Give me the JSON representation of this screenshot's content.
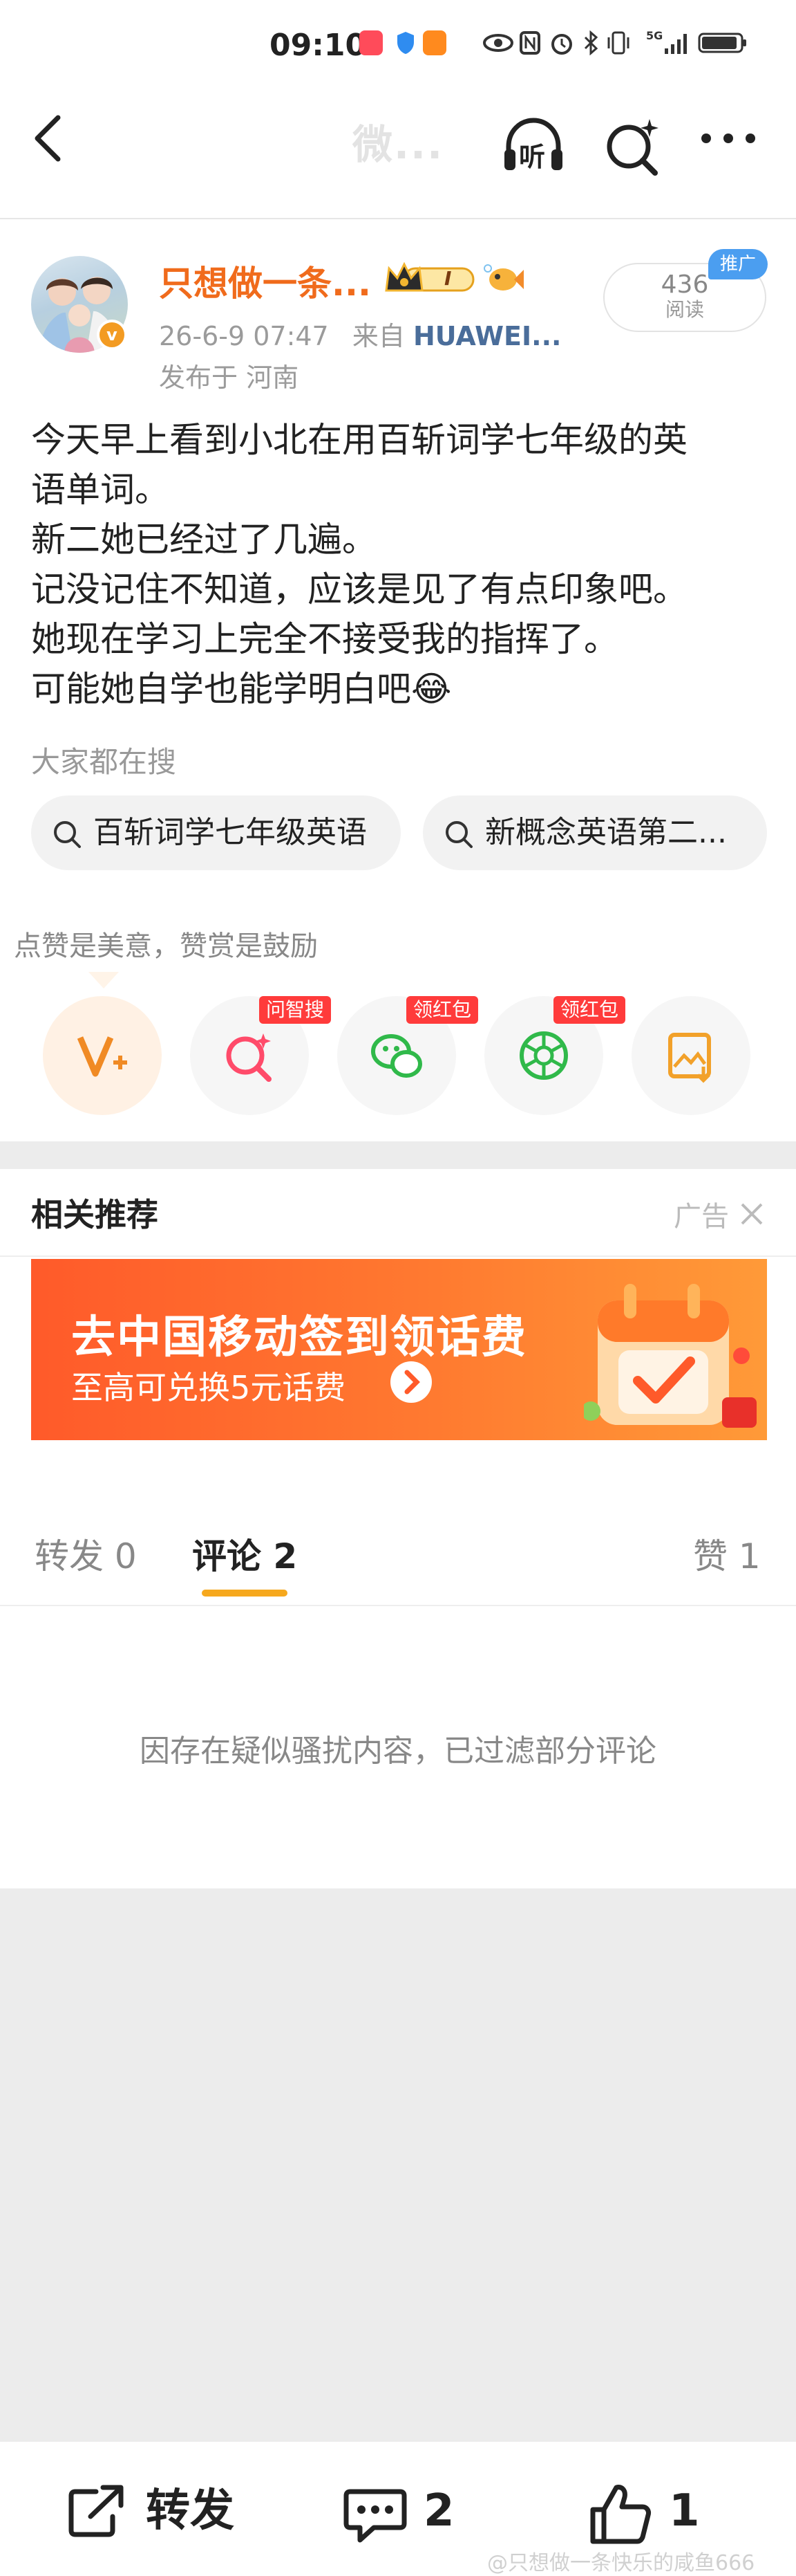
{
  "status_bar": {
    "time": "09:10",
    "network": "5G"
  },
  "nav": {
    "title": "微...",
    "listen_label": "听"
  },
  "post": {
    "username": "只想做一条...",
    "level_badge": "I",
    "avatar_badge": "v",
    "timestamp": "26-6-9 07:47",
    "source_prefix": "来自",
    "source": "HUAWEI...",
    "location": "发布于 河南",
    "read_count": "436",
    "read_label": "阅读",
    "promo_tag": "推广",
    "body_lines": [
      "今天早上看到小北在用百斩词学七年级的英",
      "语单词。",
      "新二她已经过了几遍。",
      "记没记住不知道，应该是见了有点印象吧。",
      "她现在学习上完全不接受我的指挥了。",
      "可能她自学也能学明白吧😂"
    ]
  },
  "searches": {
    "label": "大家都在搜",
    "chips": [
      "百斩词学七年级英语",
      "新概念英语第二..."
    ]
  },
  "actions": {
    "tip": "点赞是美意，赞赏是鼓励",
    "tags": [
      "问智搜",
      "领红包",
      "领红包"
    ]
  },
  "related": {
    "title": "相关推荐",
    "ad_label": "广告",
    "banner_title": "去中国移动签到领话费",
    "banner_sub": "至高可兑换5元话费"
  },
  "tabs": {
    "repost": "转发 0",
    "comment": "评论 2",
    "like": "赞 1"
  },
  "filtered_notice": "因存在疑似骚扰内容，已过滤部分评论",
  "bottom_bar": {
    "repost": "转发",
    "comment_count": "2",
    "like_count": "1"
  },
  "watermark": "@只想做一条快乐的咸鱼666",
  "colors": {
    "accent": "#f06b1c",
    "tab_indicator": "#f6a81d",
    "tag_red": "#ff3b3b",
    "promo_blue": "#4b9ef0"
  }
}
